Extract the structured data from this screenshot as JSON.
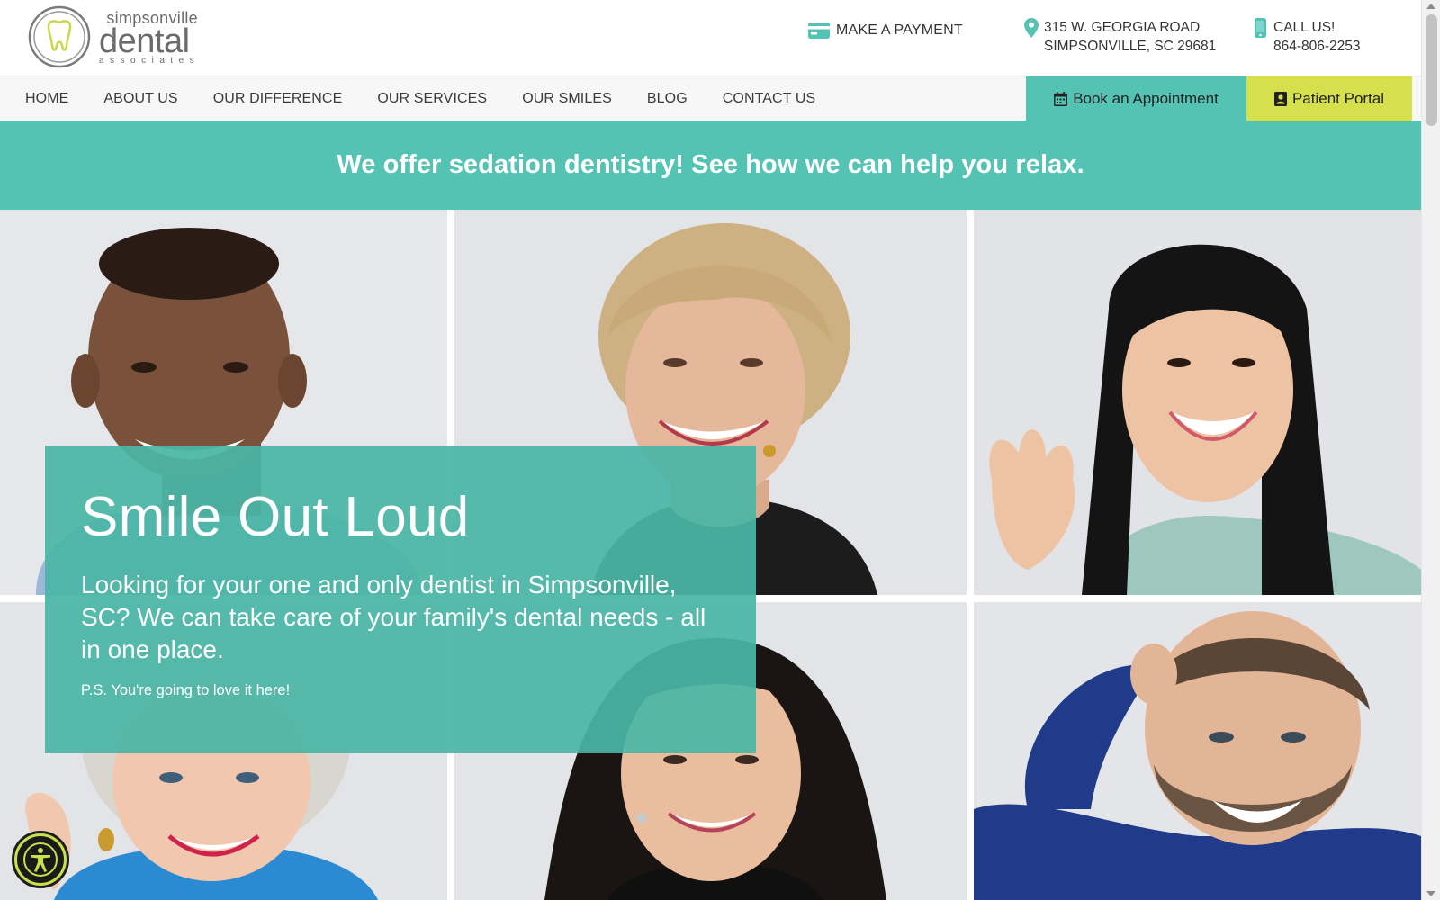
{
  "brand": {
    "logo_line1": "simpsonville",
    "logo_line2": "dental",
    "logo_line3": "associates",
    "teal": "#54c3b4",
    "lime": "#d6e04d"
  },
  "header": {
    "payment_label": "MAKE A PAYMENT",
    "payment_icon": "credit-card-icon",
    "address_line1": "315 W. GEORGIA ROAD",
    "address_line2": "SIMPSONVILLE, SC 29681",
    "address_icon": "map-pin-icon",
    "call_label": "CALL US!",
    "phone": "864-806-2253",
    "phone_icon": "mobile-phone-icon"
  },
  "nav": {
    "items": [
      {
        "label": "HOME"
      },
      {
        "label": "ABOUT US"
      },
      {
        "label": "OUR DIFFERENCE"
      },
      {
        "label": "OUR SERVICES"
      },
      {
        "label": "OUR SMILES"
      },
      {
        "label": "BLOG"
      },
      {
        "label": "CONTACT US"
      }
    ],
    "book_label": "Book an Appointment",
    "book_icon": "calendar-icon",
    "portal_label": "Patient Portal",
    "portal_icon": "user-badge-icon"
  },
  "promo": {
    "text": "We offer sedation dentistry! See how we can help you relax."
  },
  "hero": {
    "title": "Smile Out Loud",
    "subtitle": "Looking for your one and only dentist in Simpsonville, SC? We can take care of your family's dental needs - all in one place.",
    "ps": "P.S. You're going to love it here!"
  },
  "photos": [
    {
      "subject": "smiling man with short hair"
    },
    {
      "subject": "smiling older woman with blonde bob"
    },
    {
      "subject": "laughing woman with long black hair waving"
    },
    {
      "subject": "smiling older woman with grey hair"
    },
    {
      "subject": "smiling woman with dark curly hair"
    },
    {
      "subject": "laughing bearded man hand behind head"
    }
  ],
  "accessibility": {
    "icon": "accessibility-icon"
  }
}
